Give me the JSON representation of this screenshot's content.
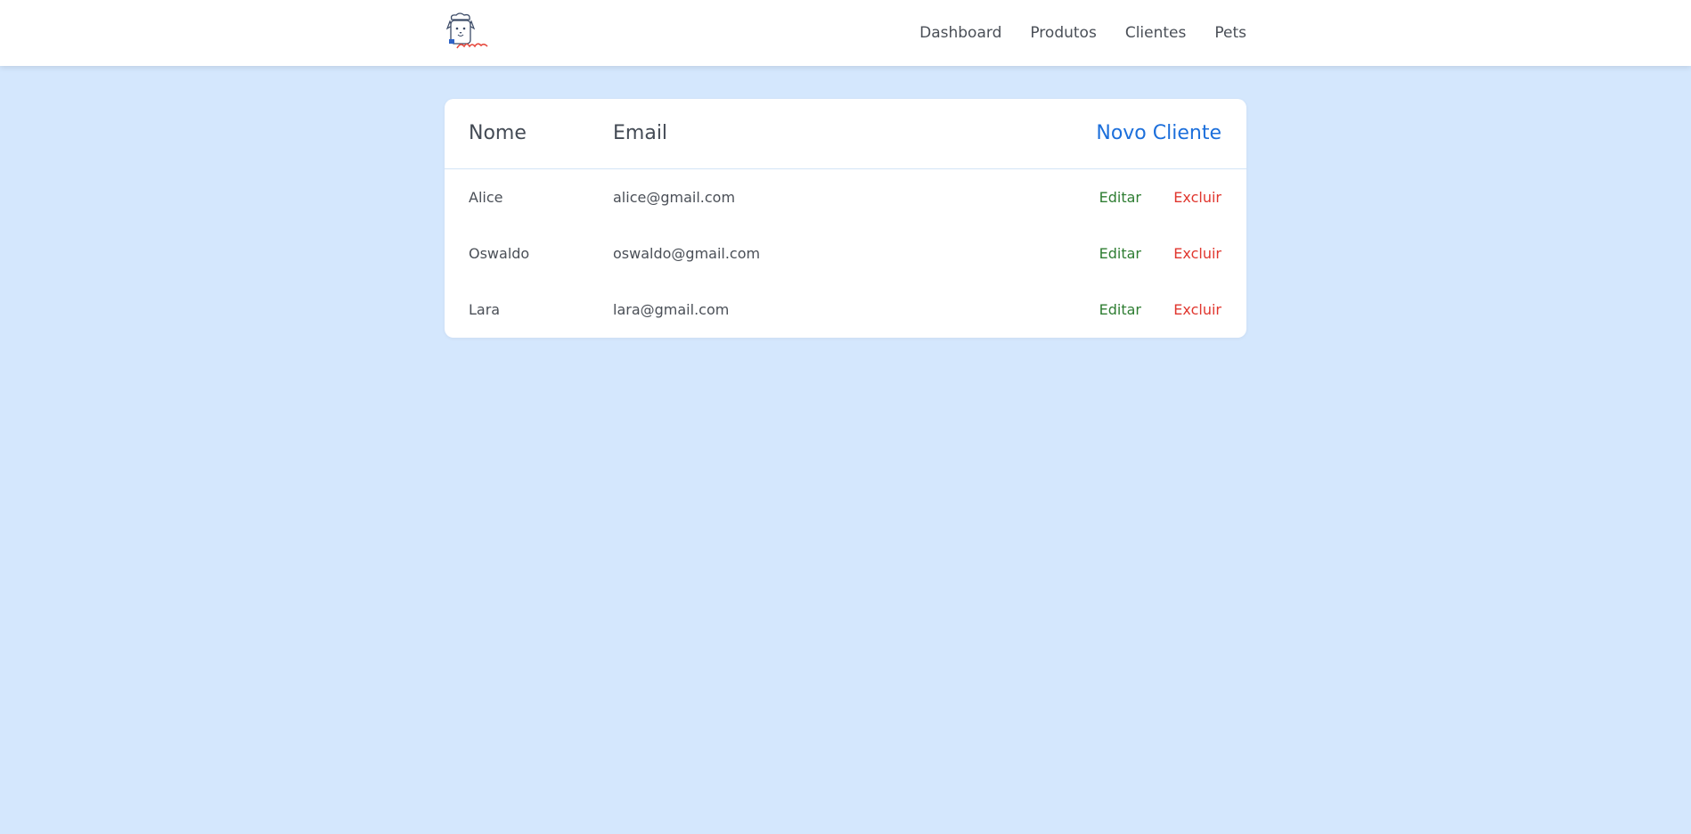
{
  "nav": {
    "logo_icon": "dog-chef-logo",
    "items": [
      {
        "label": "Dashboard"
      },
      {
        "label": "Produtos"
      },
      {
        "label": "Clientes"
      },
      {
        "label": "Pets"
      }
    ]
  },
  "table": {
    "headers": {
      "name": "Nome",
      "email": "Email"
    },
    "new_client_label": "Novo Cliente",
    "rows": [
      {
        "name": "Alice",
        "email": "alice@gmail.com",
        "edit": "Editar",
        "delete": "Excluir"
      },
      {
        "name": "Oswaldo",
        "email": "oswaldo@gmail.com",
        "edit": "Editar",
        "delete": "Excluir"
      },
      {
        "name": "Lara",
        "email": "lara@gmail.com",
        "edit": "Editar",
        "delete": "Excluir"
      }
    ]
  },
  "colors": {
    "background": "#d4e7fd",
    "accent": "#1c6fdb",
    "edit": "#2e7d32",
    "delete": "#e0362e"
  }
}
